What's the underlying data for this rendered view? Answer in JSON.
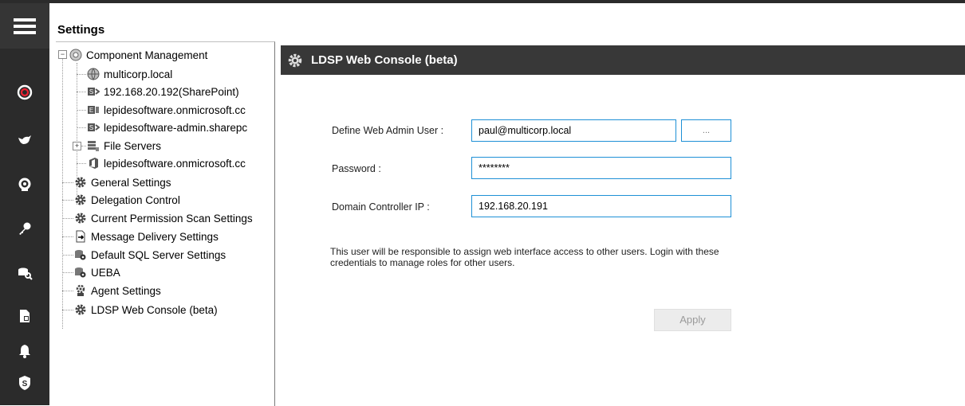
{
  "settings": {
    "title": "Settings"
  },
  "rail": {
    "icons": [
      "menu-icon",
      "target-icon",
      "bird-icon",
      "gear-person-icon",
      "key-icon",
      "database-search-icon",
      "report-icon",
      "bell-icon",
      "shield-s-icon"
    ]
  },
  "tree": {
    "root": "Component Management",
    "children": [
      "multicorp.local",
      "192.168.20.192(SharePoint)",
      "lepidesoftware.onmicrosoft.cc",
      "lepidesoftware-admin.sharepc",
      "File Servers",
      "lepidesoftware.onmicrosoft.cc"
    ],
    "items": [
      "General Settings",
      "Delegation Control",
      "Current Permission Scan Settings",
      "Message Delivery Settings",
      "Default SQL Server Settings",
      "UEBA",
      "Agent Settings",
      "LDSP Web Console (beta)"
    ]
  },
  "panel": {
    "title": "LDSP Web Console (beta)",
    "admin_label": "Define Web Admin User :",
    "admin_value": "paul@multicorp.local",
    "browse_label": "...",
    "password_label": "Password :",
    "password_value": "********",
    "dc_label": "Domain Controller IP :",
    "dc_value": "192.168.20.191",
    "note": "This user will be responsible to assign web interface access to other users. Login with these credentials to manage roles for other users.",
    "apply_label": "Apply"
  },
  "colors": {
    "rail": "#2b2b2b",
    "header": "#383838",
    "field_border": "#1e90d6"
  }
}
